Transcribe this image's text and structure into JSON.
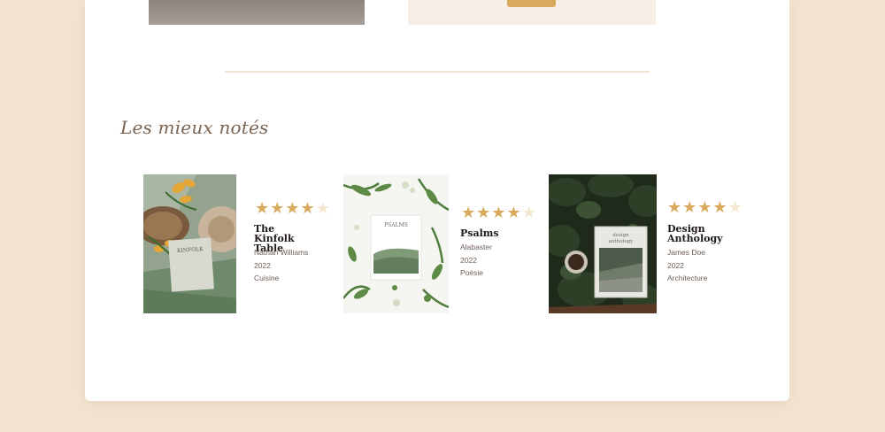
{
  "section_title": "Les mieux notés",
  "colors": {
    "accent": "#d9a95e",
    "star_empty": "#f4e6d1",
    "page_bg": "#f3e4d0",
    "title": "#7a6454"
  },
  "books": [
    {
      "title_line1": "The Kinfolk",
      "title_line2": "Table",
      "author": "Nathan Williams",
      "year": "2022",
      "genre": "Cuisine",
      "rating": 4,
      "rating_max": 5,
      "cover_text": "KINFOLK"
    },
    {
      "title_line1": "Psalms",
      "title_line2": "",
      "author": "Alabaster",
      "year": "2022",
      "genre": "Poésie",
      "rating": 4,
      "rating_max": 5,
      "cover_text": "PSALMS"
    },
    {
      "title_line1": "Design",
      "title_line2": "Anthology",
      "author": "James Doe",
      "year": "2022",
      "genre": "Architecture",
      "rating": 4,
      "rating_max": 5,
      "cover_text_line1": "design",
      "cover_text_line2": "anthology"
    }
  ]
}
